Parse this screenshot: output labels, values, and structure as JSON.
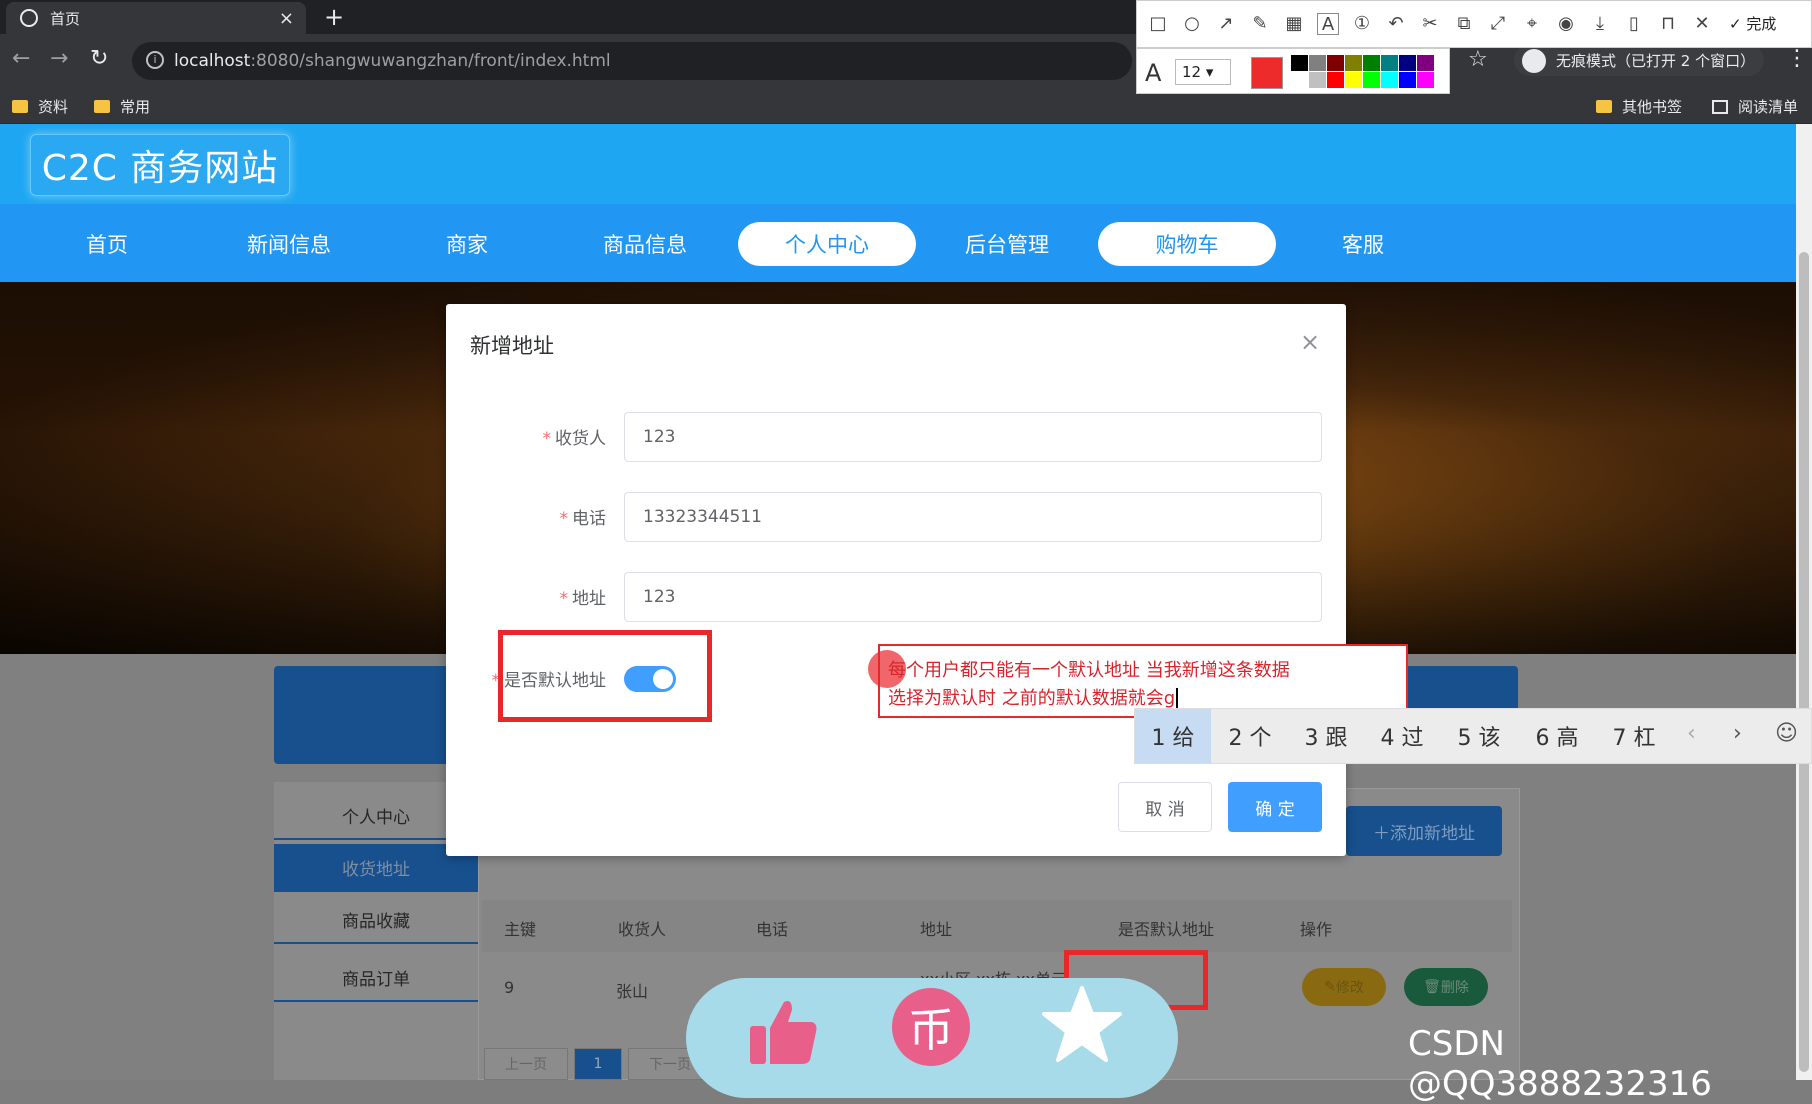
{
  "browser": {
    "tab_title": "首页",
    "tab_close": "×",
    "new_tab": "+",
    "url_host": "localhost",
    "url_rest": ":8080/shangwuwangzhan/front/index.html",
    "incognito": "无痕模式（已打开 2 个窗口）",
    "bookmarks": [
      "资料",
      "常用"
    ],
    "bookmarks_right": [
      "其他书签",
      "阅读清单"
    ]
  },
  "screenshot_tool": {
    "done_label": "完成",
    "font_size": "12",
    "current_color": "#ee2b2b",
    "palette": [
      "#000000",
      "#808080",
      "#800000",
      "#808000",
      "#008000",
      "#008080",
      "#000080",
      "#800080",
      "#ffffff",
      "#c0c0c0",
      "#ff0000",
      "#ffff00",
      "#00ff00",
      "#00ffff",
      "#0000ff",
      "#ff00ff"
    ]
  },
  "site": {
    "logo": "C2C 商务网站",
    "nav": [
      "首页",
      "新闻信息",
      "商家",
      "商品信息",
      "个人中心",
      "后台管理",
      "购物车",
      "客服"
    ],
    "active_nav": [
      "个人中心",
      "购物车"
    ]
  },
  "page": {
    "sidebar": [
      "个人中心",
      "收货地址",
      "商品收藏",
      "商品订单"
    ],
    "add_button": "添加新地址",
    "table_headers": [
      "主键",
      "收货人",
      "电话",
      "地址",
      "是否默认地址",
      "操作"
    ],
    "row": {
      "id": "9",
      "name": "张山",
      "address": "xx小区 xx栋 xx单元"
    },
    "edit": "修改",
    "delete": "删除",
    "pager": [
      "上一页",
      "1",
      "下一页"
    ]
  },
  "modal": {
    "title": "新增地址",
    "close": "×",
    "fields": [
      {
        "label": "收货人",
        "value": "123"
      },
      {
        "label": "电话",
        "value": "13323344511"
      },
      {
        "label": "地址",
        "value": "123"
      }
    ],
    "default_label": "是否默认地址",
    "default_on": true,
    "cancel": "取 消",
    "confirm": "确 定"
  },
  "annotation": {
    "line1": "每个用户都只能有一个默认地址 当我新增这条数据",
    "line2": "选择为默认时 之前的默认数据就会g"
  },
  "ime": {
    "candidates": [
      "1 给",
      "2 个",
      "3 跟",
      "4 过",
      "5 该",
      "6 高",
      "7 杠"
    ],
    "prev": "‹",
    "next": "›",
    "emoji": "☺"
  },
  "float_bar": {
    "coin_char": "币"
  },
  "watermark": "CSDN @QQ3888232316"
}
